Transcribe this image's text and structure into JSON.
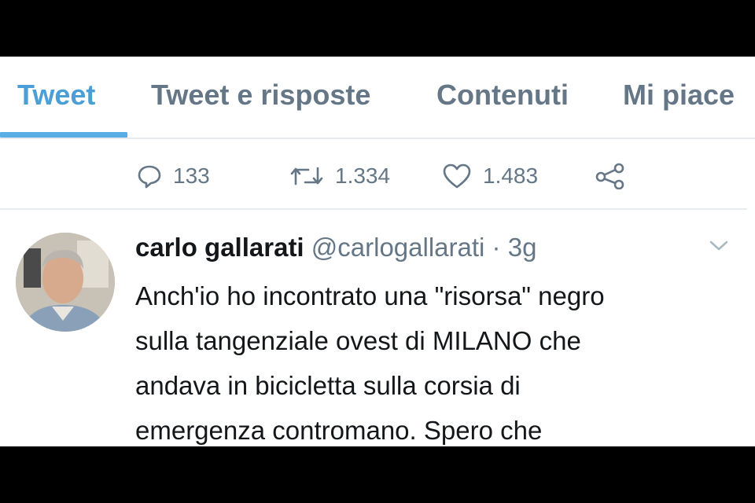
{
  "tabs": [
    {
      "label": "Tweet",
      "active": true
    },
    {
      "label": "Tweet e risposte",
      "active": false
    },
    {
      "label": "Contenuti",
      "active": false
    },
    {
      "label": "Mi piace",
      "active": false
    }
  ],
  "actions": {
    "reply_icon": "reply-icon",
    "reply_count": "133",
    "retweet_icon": "retweet-icon",
    "retweet_count": "1.334",
    "like_icon": "heart-icon",
    "like_count": "1.483",
    "share_icon": "share-icon"
  },
  "reply_tweet": {
    "user_name": "carlo gallarati",
    "handle": "@carlogallarati",
    "separator": "·",
    "timestamp": "3g",
    "menu_icon": "chevron-down-icon",
    "text_lines": [
      "Anch'io ho incontrato una \"risorsa\" negro",
      "sulla tangenziale ovest di MILANO che",
      "andava in bicicletta sulla corsia di",
      "emergenza contromano. Spero che"
    ]
  },
  "colors": {
    "accent": "#4a9fd6",
    "text_primary": "#14171a",
    "text_secondary": "#657786",
    "divider": "#e6ecf0",
    "letterbox": "#000000"
  }
}
